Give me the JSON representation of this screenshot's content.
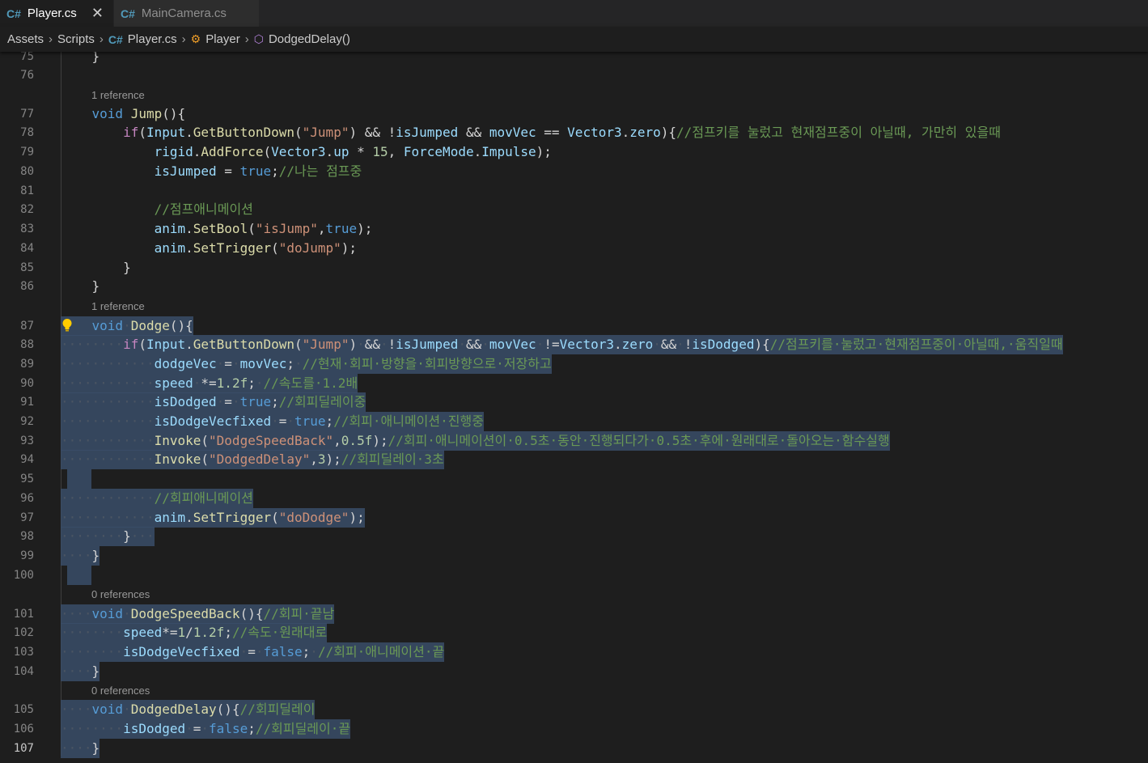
{
  "tabs": [
    {
      "label": "Player.cs",
      "icon": "csharp-file-icon",
      "active": true
    },
    {
      "label": "MainCamera.cs",
      "icon": "csharp-file-icon",
      "active": false
    }
  ],
  "breadcrumb": [
    "Assets",
    "Scripts",
    "Player.cs",
    "Player",
    "DodgedDelay()"
  ],
  "colors": {
    "background": "#1e1e1e",
    "keyword": "#569cd6",
    "function": "#dcdcaa",
    "variable": "#9cdcfe",
    "string": "#ce9178",
    "comment": "#6a9955",
    "selection": "#3a4d68"
  },
  "codelens": {
    "before_77": "1 reference",
    "before_87": "1 reference",
    "before_101": "0 references",
    "before_105": "0 references"
  },
  "lines": [
    {
      "n": "75",
      "tokens": [
        [
          "",
          "    }"
        ]
      ]
    },
    {
      "n": "76",
      "tokens": []
    },
    {
      "n": "77",
      "tokens": [
        [
          "",
          "    "
        ],
        [
          "kw",
          "void"
        ],
        [
          "",
          " "
        ],
        [
          "fn",
          "Jump"
        ],
        [
          "",
          "(){"
        ]
      ]
    },
    {
      "n": "78",
      "tokens": [
        [
          "",
          "        "
        ],
        [
          "ctl",
          "if"
        ],
        [
          "",
          "("
        ],
        [
          "id",
          "Input"
        ],
        [
          "",
          "."
        ],
        [
          "fn",
          "GetButtonDown"
        ],
        [
          "",
          "("
        ],
        [
          "str",
          "\"Jump\""
        ],
        [
          "",
          ") && !"
        ],
        [
          "id",
          "isJumped"
        ],
        [
          "",
          " && "
        ],
        [
          "id",
          "movVec"
        ],
        [
          "",
          " == "
        ],
        [
          "id",
          "Vector3"
        ],
        [
          "",
          "."
        ],
        [
          "id",
          "zero"
        ],
        [
          "",
          "){"
        ],
        [
          "cm",
          "//점프키를 눌렀고 현재점프중이 아닐때, 가만히 있을때"
        ]
      ]
    },
    {
      "n": "79",
      "tokens": [
        [
          "",
          "            "
        ],
        [
          "id",
          "rigid"
        ],
        [
          "",
          "."
        ],
        [
          "fn",
          "AddForce"
        ],
        [
          "",
          "("
        ],
        [
          "id",
          "Vector3"
        ],
        [
          "",
          "."
        ],
        [
          "id",
          "up"
        ],
        [
          "",
          " * "
        ],
        [
          "num",
          "15"
        ],
        [
          "",
          ", "
        ],
        [
          "id",
          "ForceMode"
        ],
        [
          "",
          "."
        ],
        [
          "id",
          "Impulse"
        ],
        [
          "",
          ");"
        ]
      ]
    },
    {
      "n": "80",
      "tokens": [
        [
          "",
          "            "
        ],
        [
          "id",
          "isJumped"
        ],
        [
          "",
          " = "
        ],
        [
          "kw",
          "true"
        ],
        [
          "",
          ";"
        ],
        [
          "cm",
          "//나는 점프중"
        ]
      ]
    },
    {
      "n": "81",
      "tokens": []
    },
    {
      "n": "82",
      "tokens": [
        [
          "",
          "            "
        ],
        [
          "cm",
          "//점프애니메이션"
        ]
      ]
    },
    {
      "n": "83",
      "tokens": [
        [
          "",
          "            "
        ],
        [
          "id",
          "anim"
        ],
        [
          "",
          "."
        ],
        [
          "fn",
          "SetBool"
        ],
        [
          "",
          "("
        ],
        [
          "str",
          "\"isJump\""
        ],
        [
          "",
          ","
        ],
        [
          "kw",
          "true"
        ],
        [
          "",
          ");"
        ]
      ]
    },
    {
      "n": "84",
      "tokens": [
        [
          "",
          "            "
        ],
        [
          "id",
          "anim"
        ],
        [
          "",
          "."
        ],
        [
          "fn",
          "SetTrigger"
        ],
        [
          "",
          "("
        ],
        [
          "str",
          "\"doJump\""
        ],
        [
          "",
          ");"
        ]
      ]
    },
    {
      "n": "85",
      "tokens": [
        [
          "",
          "        }"
        ]
      ]
    },
    {
      "n": "86",
      "tokens": [
        [
          "",
          "    }"
        ]
      ]
    },
    {
      "n": "87",
      "tokens": [
        [
          "",
          "    "
        ],
        [
          "kw",
          "void"
        ],
        [
          "ws",
          "·"
        ],
        [
          "fn",
          "Dodge"
        ],
        [
          "",
          "(){"
        ]
      ],
      "sel": true
    },
    {
      "n": "88",
      "tokens": [
        [
          "ws",
          "········"
        ],
        [
          "ctl",
          "if"
        ],
        [
          "",
          "("
        ],
        [
          "id",
          "Input"
        ],
        [
          "",
          "."
        ],
        [
          "fn",
          "GetButtonDown"
        ],
        [
          "",
          "("
        ],
        [
          "str",
          "\"Jump\""
        ],
        [
          "",
          ")"
        ],
        [
          "ws",
          "·"
        ],
        [
          "",
          "&&"
        ],
        [
          "ws",
          "·"
        ],
        [
          "",
          "!"
        ],
        [
          "id",
          "isJumped"
        ],
        [
          "ws",
          "·"
        ],
        [
          "",
          "&&"
        ],
        [
          "ws",
          "·"
        ],
        [
          "id",
          "movVec"
        ],
        [
          "ws",
          "·"
        ],
        [
          "",
          "!="
        ],
        [
          "id",
          "Vector3"
        ],
        [
          "",
          "."
        ],
        [
          "id",
          "zero"
        ],
        [
          "ws",
          "·"
        ],
        [
          "",
          "&&"
        ],
        [
          "ws",
          "·"
        ],
        [
          "",
          "!"
        ],
        [
          "id",
          "isDodged"
        ],
        [
          "",
          "){"
        ],
        [
          "cm",
          "//점프키를·눌렀고·현재점프중이·아닐때,·움직일때"
        ]
      ],
      "sel": true
    },
    {
      "n": "89",
      "tokens": [
        [
          "ws",
          "············"
        ],
        [
          "id",
          "dodgeVec"
        ],
        [
          "ws",
          "·"
        ],
        [
          "",
          "="
        ],
        [
          "ws",
          "·"
        ],
        [
          "id",
          "movVec"
        ],
        [
          "",
          ";"
        ],
        [
          "ws",
          "·"
        ],
        [
          "cm",
          "//현재·회피·방향을·회피방향으로·저장하고"
        ]
      ],
      "sel": true
    },
    {
      "n": "90",
      "tokens": [
        [
          "ws",
          "············"
        ],
        [
          "id",
          "speed"
        ],
        [
          "ws",
          "·"
        ],
        [
          "",
          "*="
        ],
        [
          "num",
          "1.2f"
        ],
        [
          "",
          ";"
        ],
        [
          "ws",
          "·"
        ],
        [
          "cm",
          "//속도를·1.2배"
        ]
      ],
      "sel": true
    },
    {
      "n": "91",
      "tokens": [
        [
          "ws",
          "············"
        ],
        [
          "id",
          "isDodged"
        ],
        [
          "ws",
          "·"
        ],
        [
          "",
          "="
        ],
        [
          "ws",
          "·"
        ],
        [
          "kw",
          "true"
        ],
        [
          "",
          ";"
        ],
        [
          "cm",
          "//회피딜레이중"
        ]
      ],
      "sel": true
    },
    {
      "n": "92",
      "tokens": [
        [
          "ws",
          "············"
        ],
        [
          "id",
          "isDodgeVecfixed"
        ],
        [
          "ws",
          "·"
        ],
        [
          "",
          "="
        ],
        [
          "ws",
          "·"
        ],
        [
          "kw",
          "true"
        ],
        [
          "",
          ";"
        ],
        [
          "cm",
          "//회피·애니메이션·진행중"
        ]
      ],
      "sel": true
    },
    {
      "n": "93",
      "tokens": [
        [
          "ws",
          "············"
        ],
        [
          "fn",
          "Invoke"
        ],
        [
          "",
          "("
        ],
        [
          "str",
          "\"DodgeSpeedBack\""
        ],
        [
          "",
          ","
        ],
        [
          "num",
          "0.5f"
        ],
        [
          "",
          ");"
        ],
        [
          "cm",
          "//회피·애니메이션이·0.5초·동안·진행되다가·0.5초·후에·원래대로·돌아오는·함수실행"
        ]
      ],
      "sel": true
    },
    {
      "n": "94",
      "tokens": [
        [
          "ws",
          "············"
        ],
        [
          "fn",
          "Invoke"
        ],
        [
          "",
          "("
        ],
        [
          "str",
          "\"DodgedDelay\""
        ],
        [
          "",
          ","
        ],
        [
          "num",
          "3"
        ],
        [
          "",
          ");"
        ],
        [
          "cm",
          "//회피딜레이·3초"
        ]
      ],
      "sel": true
    },
    {
      "n": "95",
      "tokens": [
        [
          "",
          "  "
        ]
      ],
      "sel": true,
      "short": true
    },
    {
      "n": "96",
      "tokens": [
        [
          "ws",
          "············"
        ],
        [
          "cm",
          "//회피애니메이션"
        ]
      ],
      "sel": true
    },
    {
      "n": "97",
      "tokens": [
        [
          "ws",
          "············"
        ],
        [
          "id",
          "anim"
        ],
        [
          "",
          "."
        ],
        [
          "fn",
          "SetTrigger"
        ],
        [
          "",
          "("
        ],
        [
          "str",
          "\"doDodge\""
        ],
        [
          "",
          ");"
        ]
      ],
      "sel": true
    },
    {
      "n": "98",
      "tokens": [
        [
          "ws",
          "········"
        ],
        [
          "",
          "}"
        ],
        [
          "ws",
          "···"
        ]
      ],
      "sel": true
    },
    {
      "n": "99",
      "tokens": [
        [
          "ws",
          "····"
        ],
        [
          "",
          "}"
        ]
      ],
      "sel": true
    },
    {
      "n": "100",
      "tokens": [
        [
          "",
          "  "
        ]
      ],
      "sel": true,
      "short": true
    },
    {
      "n": "101",
      "tokens": [
        [
          "ws",
          "····"
        ],
        [
          "kw",
          "void"
        ],
        [
          "ws",
          "·"
        ],
        [
          "fn",
          "DodgeSpeedBack"
        ],
        [
          "",
          "(){"
        ],
        [
          "cm",
          "//회피·끝남"
        ]
      ],
      "sel": true
    },
    {
      "n": "102",
      "tokens": [
        [
          "ws",
          "········"
        ],
        [
          "id",
          "speed"
        ],
        [
          "",
          "*="
        ],
        [
          "num",
          "1"
        ],
        [
          "",
          "/"
        ],
        [
          "num",
          "1.2f"
        ],
        [
          "",
          ";"
        ],
        [
          "cm",
          "//속도·원래대로"
        ]
      ],
      "sel": true
    },
    {
      "n": "103",
      "tokens": [
        [
          "ws",
          "········"
        ],
        [
          "id",
          "isDodgeVecfixed"
        ],
        [
          "ws",
          "·"
        ],
        [
          "",
          "="
        ],
        [
          "ws",
          "·"
        ],
        [
          "kw",
          "false"
        ],
        [
          "",
          ";"
        ],
        [
          "ws",
          "·"
        ],
        [
          "cm",
          "//회피·애니메이션·끝"
        ]
      ],
      "sel": true
    },
    {
      "n": "104",
      "tokens": [
        [
          "ws",
          "····"
        ],
        [
          "",
          "}"
        ]
      ],
      "sel": true
    },
    {
      "n": "105",
      "tokens": [
        [
          "ws",
          "····"
        ],
        [
          "kw",
          "void"
        ],
        [
          "ws",
          "·"
        ],
        [
          "fn",
          "DodgedDelay"
        ],
        [
          "",
          "(){"
        ],
        [
          "cm",
          "//회피딜레이"
        ]
      ],
      "sel": true
    },
    {
      "n": "106",
      "tokens": [
        [
          "ws",
          "········"
        ],
        [
          "id",
          "isDodged"
        ],
        [
          "ws",
          "·"
        ],
        [
          "",
          "="
        ],
        [
          "ws",
          "·"
        ],
        [
          "kw",
          "false"
        ],
        [
          "",
          ";"
        ],
        [
          "cm",
          "//회피딜레이·끝"
        ]
      ],
      "sel": true
    },
    {
      "n": "107",
      "tokens": [
        [
          "ws",
          "····"
        ],
        [
          "",
          "}"
        ]
      ],
      "sel": true,
      "current": true
    }
  ]
}
